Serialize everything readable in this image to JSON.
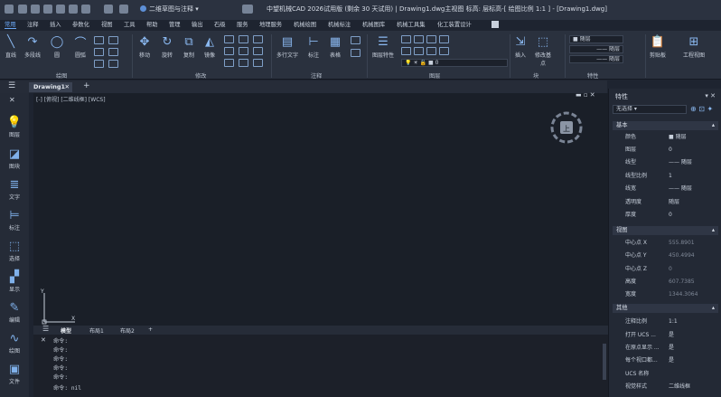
{
  "title_bar": {
    "workspace": "二维草图与注释",
    "app_title": "中望机械CAD 2026试用版 (剩余 30 天试用) | Drawing1.dwg主视图  标高: 层标高-[ 绘图比例 1:1 ] - [Drawing1.dwg]"
  },
  "menu": [
    "常用",
    "注释",
    "插入",
    "参数化",
    "视图",
    "工具",
    "帮助",
    "管理",
    "输出",
    "石级",
    "服务",
    "地理服务",
    "机械绘图",
    "机械标注",
    "机械图库",
    "机械工具集",
    "化工装置设计"
  ],
  "ribbon": {
    "draw": {
      "label": "绘图",
      "buttons": [
        "直线",
        "多段线",
        "圆",
        "圆弧"
      ]
    },
    "modify": {
      "label": "修改",
      "buttons": [
        "移动",
        "旋转",
        "复制",
        "镜像"
      ]
    },
    "annotation": {
      "label": "注释",
      "buttons": [
        "多行文字",
        "标注",
        "表格"
      ]
    },
    "layers": {
      "label": "图层",
      "buttons": [
        "图层特性"
      ],
      "layer_value": "0"
    },
    "block": {
      "label": "块",
      "buttons": [
        "插入",
        "修改基点"
      ]
    },
    "properties": {
      "label": "特性",
      "bylayer": "随层"
    },
    "clipboard": "剪贴板",
    "view_tool": "工程视图"
  },
  "tabs": {
    "document": "Drawing1"
  },
  "left_toolbar": [
    "图层",
    "图块",
    "文字",
    "标注",
    "选择",
    "显示",
    "编辑",
    "绘图",
    "文件"
  ],
  "canvas": {
    "view_label": "[-] [俯视] [二维线框] [WCS]",
    "axis_x": "X",
    "axis_y": "Y"
  },
  "layout_tabs": [
    "模型",
    "布局1",
    "布局2"
  ],
  "command_lines": [
    "命令:",
    "命令:",
    "命令:",
    "命令:",
    "命令:",
    "命令: nil"
  ],
  "properties_panel": {
    "title": "特性",
    "selector": "无选择",
    "sections": [
      {
        "name": "基本",
        "rows": [
          {
            "k": "颜色",
            "v": "■ 随层"
          },
          {
            "k": "图层",
            "v": "0"
          },
          {
            "k": "线型",
            "v": "—— 随层"
          },
          {
            "k": "线型比例",
            "v": "1"
          },
          {
            "k": "线宽",
            "v": "—— 随层"
          },
          {
            "k": "透明度",
            "v": "随层"
          },
          {
            "k": "厚度",
            "v": "0"
          }
        ]
      },
      {
        "name": "视图",
        "rows": [
          {
            "k": "中心点 X",
            "v": "555.8901"
          },
          {
            "k": "中心点 Y",
            "v": "450.4994"
          },
          {
            "k": "中心点 Z",
            "v": "0"
          },
          {
            "k": "高度",
            "v": "607.7385"
          },
          {
            "k": "宽度",
            "v": "1344.3064"
          }
        ]
      },
      {
        "name": "其他",
        "rows": [
          {
            "k": "注释比例",
            "v": "1:1"
          },
          {
            "k": "打开 UCS ...",
            "v": "是"
          },
          {
            "k": "在原点显示 ...",
            "v": "是"
          },
          {
            "k": "每个视口都...",
            "v": "是"
          },
          {
            "k": "UCS 名称",
            "v": ""
          },
          {
            "k": "视觉样式",
            "v": "二维线框"
          }
        ]
      }
    ]
  }
}
